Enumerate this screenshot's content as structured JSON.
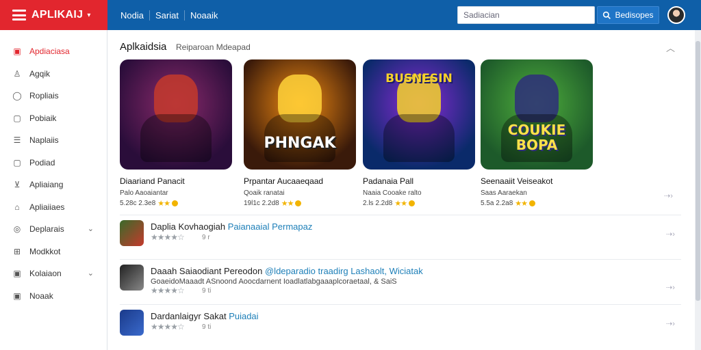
{
  "header": {
    "brand": "APLIKAIJ",
    "nav": [
      "Nodia",
      "Sariat",
      "Noaaik"
    ],
    "search_placeholder": "Sadiacian",
    "search_button": "Bedisopes"
  },
  "sidebar": {
    "items": [
      {
        "label": "Apdiaciasa",
        "icon": "apps-icon",
        "active": true
      },
      {
        "label": "Agqik",
        "icon": "user-icon"
      },
      {
        "label": "Ropliais",
        "icon": "circle-icon"
      },
      {
        "label": "Pobiaik",
        "icon": "doc-icon"
      },
      {
        "label": "Naplaiis",
        "icon": "list-icon"
      },
      {
        "label": "Podiad",
        "icon": "doc-icon"
      },
      {
        "label": "Apliaiang",
        "icon": "download-icon"
      },
      {
        "label": "Apliaiiaes",
        "icon": "home-icon"
      },
      {
        "label": "Deplarais",
        "icon": "globe-icon",
        "chevron": true
      },
      {
        "label": "Modkkot",
        "icon": "grid-icon"
      },
      {
        "label": "Kolaiaon",
        "icon": "square-icon",
        "chevron": true
      },
      {
        "label": "Noaak",
        "icon": "square-icon"
      }
    ]
  },
  "main": {
    "title": "Aplkaidsia",
    "subtitle": "Reiparoan Mdeapad",
    "featured": [
      {
        "art": "",
        "name": "Diaariand Panacit",
        "dev": "Palo Aaoaiantar",
        "meta": "5.28c 2.3e8",
        "colors": [
          "#2a0d3a",
          "#8a2a6b"
        ],
        "accent": "#c43a2c"
      },
      {
        "art": "PHNGAK",
        "name": "Prpantar Aucaaeqaad",
        "dev": "Qoaik ranatai",
        "meta": "19l1c 2.2d8",
        "colors": [
          "#3a1a0a",
          "#f08a12"
        ],
        "accent": "#ffd23a"
      },
      {
        "art": "BUSNESIN",
        "name": "Padanaia Pall",
        "dev": "Naaia Cooake ralto",
        "meta": "2.ls 2.2d8",
        "colors": [
          "#0a2a6a",
          "#8a2ad6"
        ],
        "accent": "#f6d22a"
      },
      {
        "art": "COUKIE BOPA",
        "name": "Seenaaiit Veiseakot",
        "dev": "Saas Aaraekan",
        "meta": "5.5a 2.2a8",
        "colors": [
          "#1d5a2a",
          "#4fae3c"
        ],
        "accent": "#2e2e7a"
      }
    ],
    "list": [
      {
        "title": "Daplia Kovhaogiah",
        "tag": "Paianaaial Permapaz",
        "desc": "",
        "extra": "9 r",
        "colors": [
          "#3a6a2a",
          "#c43a2c"
        ]
      },
      {
        "title": "Daaah Saiaodiant Pereodon",
        "tag": "@ldeparadio traadirg Lashaolt, Wiciatak",
        "desc": "GoaeidoMaaadt ASnoond Aoocdarnent Ioadlatlabgaaaplcoraetaal, & SaiS",
        "extra": "9 ti",
        "colors": [
          "#222",
          "#888"
        ]
      },
      {
        "title": "Dardanlaigyr Sakat",
        "tag": "Puiadai",
        "desc": "",
        "extra": "9 ti",
        "colors": [
          "#1a3a8a",
          "#3a6acc"
        ]
      }
    ]
  }
}
